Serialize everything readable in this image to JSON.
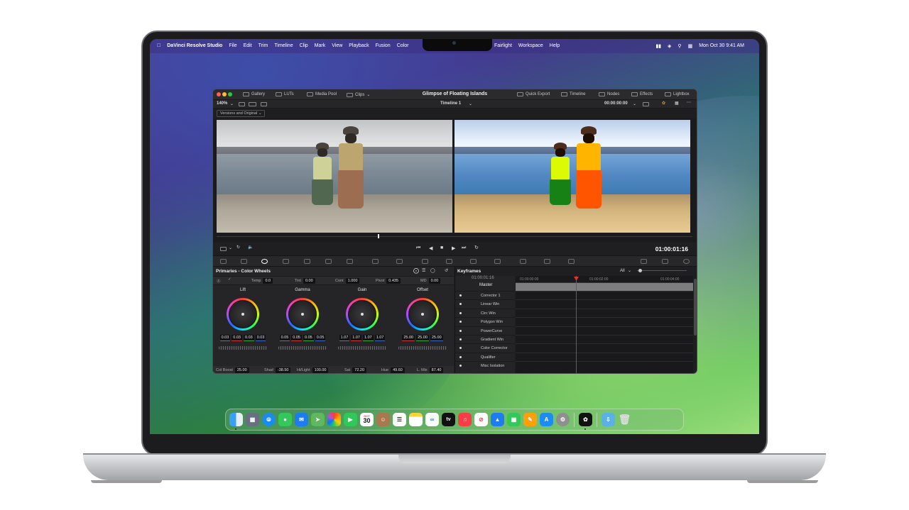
{
  "menubar": {
    "app": "DaVinci Resolve Studio",
    "items_left": [
      "File",
      "Edit",
      "Trim",
      "Timeline",
      "Clip",
      "Mark",
      "View",
      "Playback",
      "Fusion",
      "Color"
    ],
    "items_mid": [
      "Fairlight",
      "Workspace",
      "Help"
    ],
    "datetime": "Mon Oct 30  9:41 AM"
  },
  "window": {
    "title": "Glimpse of Floating Islands",
    "toolbar_left": [
      "Gallery",
      "LUTs",
      "Media Pool",
      "Clips"
    ],
    "toolbar_right": [
      "Quick Export",
      "Timeline",
      "Nodes",
      "Effects",
      "Lightbox"
    ],
    "zoom": "140%",
    "timeline_name": "Timeline 1",
    "timecode_top": "00:00:00:00",
    "versions_label": "Versions and Original",
    "timecode": "01:00:01:16"
  },
  "primaries": {
    "title": "Primaries - Color Wheels",
    "temp_label": "Temp",
    "temp": "0.0",
    "tint_label": "Tint",
    "tint": "0.00",
    "cont_label": "Cont",
    "cont": "1.000",
    "pivot_label": "Pivot",
    "pivot": "0.435",
    "md_label": "MD",
    "md": "0.00",
    "wheels": [
      {
        "name": "Lift",
        "values": [
          "0.03",
          "0.03",
          "0.03",
          "0.03"
        ]
      },
      {
        "name": "Gamma",
        "values": [
          "0.05",
          "0.05",
          "0.05",
          "0.05"
        ]
      },
      {
        "name": "Gain",
        "values": [
          "1.07",
          "1.07",
          "1.07",
          "1.07"
        ]
      },
      {
        "name": "Offset",
        "values": [
          "25.00",
          "25.00",
          "25.00"
        ]
      }
    ],
    "colboost_label": "Col Boost",
    "colboost": "25.00",
    "shad_label": "Shad",
    "shad": "-38.50",
    "hilight_label": "Hi/Light",
    "hilight": "100.00",
    "sat_label": "Sat",
    "sat": "72.20",
    "hue_label": "Hue",
    "hue": "49.60",
    "lmix_label": "L. Mix",
    "lmix": "87.40"
  },
  "keyframes": {
    "title": "Keyframes",
    "filter": "All",
    "timecode": "01:00:01:16",
    "master": "Master",
    "rows": [
      "Corrector 1",
      "Linear Win",
      "Circ Win",
      "Polygon Win",
      "PowerCurve",
      "Gradient Win",
      "Color Corrector",
      "Qualifier",
      "Misc Isolation"
    ],
    "ruler": [
      "01:00:00:00",
      "01:00:02:00",
      "01:00:04:00"
    ]
  },
  "dock": {
    "calendar_month": "OCT",
    "calendar_day": "30",
    "tv_label": "tv"
  },
  "colors": {
    "playhead": "#d92b2b",
    "accent_red": "#e0312f"
  }
}
